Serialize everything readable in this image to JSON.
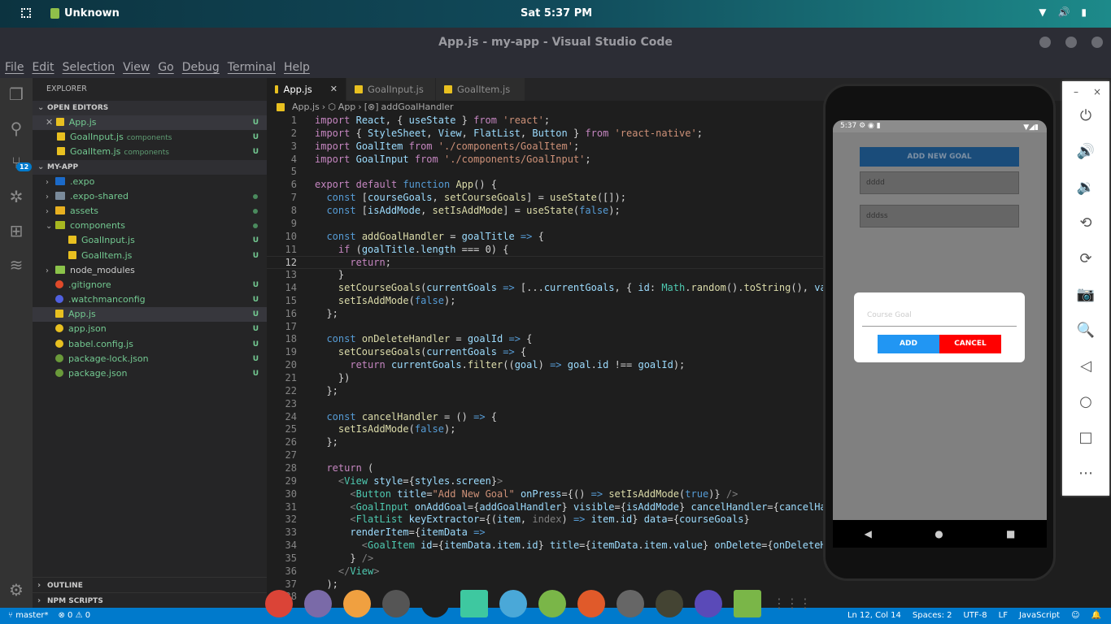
{
  "topbar": {
    "app_name": "Unknown",
    "clock": "Sat  5:37 PM",
    "tray_icons": [
      "wifi-icon",
      "volume-icon",
      "battery-icon"
    ]
  },
  "window": {
    "title": "App.js - my-app - Visual Studio Code"
  },
  "menu": [
    "File",
    "Edit",
    "Selection",
    "View",
    "Go",
    "Debug",
    "Terminal",
    "Help"
  ],
  "activity": {
    "icons": [
      "files-icon",
      "search-icon",
      "source-control-icon",
      "debug-icon",
      "extensions-icon",
      "docker-icon",
      "gear-icon"
    ],
    "scm_badge": "12"
  },
  "sidebar": {
    "title": "EXPLORER",
    "open_editors_label": "OPEN EDITORS",
    "open_editors": [
      {
        "name": "App.js",
        "desc": "",
        "status": "U"
      },
      {
        "name": "GoalInput.js",
        "desc": "components",
        "status": "U"
      },
      {
        "name": "GoalItem.js",
        "desc": "components",
        "status": "U"
      }
    ],
    "project_label": "MY-APP",
    "tree": [
      {
        "name": ".expo",
        "kind": "folder",
        "depth": 0,
        "chev": "›",
        "status": "",
        "color": "#1b6ac9"
      },
      {
        "name": ".expo-shared",
        "kind": "folder",
        "depth": 0,
        "chev": "›",
        "status": "dot",
        "color": "#7a8a9a"
      },
      {
        "name": "assets",
        "kind": "folder",
        "depth": 0,
        "chev": "›",
        "status": "dot",
        "color": "#e8b020"
      },
      {
        "name": "components",
        "kind": "folder",
        "depth": 0,
        "chev": "⌄",
        "status": "dot",
        "color": "#a8b820"
      },
      {
        "name": "GoalInput.js",
        "kind": "js",
        "depth": 1,
        "chev": "",
        "status": "U"
      },
      {
        "name": "GoalItem.js",
        "kind": "js",
        "depth": 1,
        "chev": "",
        "status": "U"
      },
      {
        "name": "node_modules",
        "kind": "folder",
        "depth": 0,
        "chev": "›",
        "status": "",
        "color": "#8bc34a"
      },
      {
        "name": ".gitignore",
        "kind": "other",
        "depth": 0,
        "chev": "",
        "status": "U",
        "color": "#e04a2a"
      },
      {
        "name": ".watchmanconfig",
        "kind": "other",
        "depth": 0,
        "chev": "",
        "status": "U",
        "color": "#5060e0"
      },
      {
        "name": "App.js",
        "kind": "js",
        "depth": 0,
        "chev": "",
        "status": "U",
        "selected": true
      },
      {
        "name": "app.json",
        "kind": "other",
        "depth": 0,
        "chev": "",
        "status": "U",
        "color": "#e8c020"
      },
      {
        "name": "babel.config.js",
        "kind": "other",
        "depth": 0,
        "chev": "",
        "status": "U",
        "color": "#e8c020"
      },
      {
        "name": "package-lock.json",
        "kind": "other",
        "depth": 0,
        "chev": "",
        "status": "U",
        "color": "#6a9a3a"
      },
      {
        "name": "package.json",
        "kind": "other",
        "depth": 0,
        "chev": "",
        "status": "U",
        "color": "#6a9a3a"
      }
    ],
    "outline_label": "OUTLINE",
    "npm_label": "NPM SCRIPTS"
  },
  "tabs": [
    {
      "label": "App.js",
      "active": true
    },
    {
      "label": "GoalInput.js"
    },
    {
      "label": "GoalItem.js"
    }
  ],
  "breadcrumb": [
    "App.js",
    "App",
    "addGoalHandler"
  ],
  "editor": {
    "current_line": 12,
    "lines": [
      [
        [
          "k",
          "import"
        ],
        [
          "p",
          " "
        ],
        [
          "v",
          "React"
        ],
        [
          "p",
          ", { "
        ],
        [
          "v",
          "useState"
        ],
        [
          "p",
          " } "
        ],
        [
          "k",
          "from"
        ],
        [
          "p",
          " "
        ],
        [
          "s",
          "'react'"
        ],
        [
          "p",
          ";"
        ]
      ],
      [
        [
          "k",
          "import"
        ],
        [
          "p",
          " { "
        ],
        [
          "v",
          "StyleSheet"
        ],
        [
          "p",
          ", "
        ],
        [
          "v",
          "View"
        ],
        [
          "p",
          ", "
        ],
        [
          "v",
          "FlatList"
        ],
        [
          "p",
          ", "
        ],
        [
          "v",
          "Button"
        ],
        [
          "p",
          " } "
        ],
        [
          "k",
          "from"
        ],
        [
          "p",
          " "
        ],
        [
          "s",
          "'react-native'"
        ],
        [
          "p",
          ";"
        ]
      ],
      [
        [
          "k",
          "import"
        ],
        [
          "p",
          " "
        ],
        [
          "v",
          "GoalItem"
        ],
        [
          "p",
          " "
        ],
        [
          "k",
          "from"
        ],
        [
          "p",
          " "
        ],
        [
          "s",
          "'./components/GoalItem'"
        ],
        [
          "p",
          ";"
        ]
      ],
      [
        [
          "k",
          "import"
        ],
        [
          "p",
          " "
        ],
        [
          "v",
          "GoalInput"
        ],
        [
          "p",
          " "
        ],
        [
          "k",
          "from"
        ],
        [
          "p",
          " "
        ],
        [
          "s",
          "'./components/GoalInput'"
        ],
        [
          "p",
          ";"
        ]
      ],
      [],
      [
        [
          "k",
          "export"
        ],
        [
          "p",
          " "
        ],
        [
          "k",
          "default"
        ],
        [
          "p",
          " "
        ],
        [
          "b",
          "function"
        ],
        [
          "p",
          " "
        ],
        [
          "f",
          "App"
        ],
        [
          "p",
          "() {"
        ]
      ],
      [
        [
          "p",
          "  "
        ],
        [
          "b",
          "const"
        ],
        [
          "p",
          " ["
        ],
        [
          "v",
          "courseGoals"
        ],
        [
          "p",
          ", "
        ],
        [
          "f",
          "setCourseGoals"
        ],
        [
          "p",
          "] = "
        ],
        [
          "f",
          "useState"
        ],
        [
          "p",
          "([]);"
        ]
      ],
      [
        [
          "p",
          "  "
        ],
        [
          "b",
          "const"
        ],
        [
          "p",
          " ["
        ],
        [
          "v",
          "isAddMode"
        ],
        [
          "p",
          ", "
        ],
        [
          "f",
          "setIsAddMode"
        ],
        [
          "p",
          "] = "
        ],
        [
          "f",
          "useState"
        ],
        [
          "p",
          "("
        ],
        [
          "b",
          "false"
        ],
        [
          "p",
          ");"
        ]
      ],
      [],
      [
        [
          "p",
          "  "
        ],
        [
          "b",
          "const"
        ],
        [
          "p",
          " "
        ],
        [
          "f",
          "addGoalHandler"
        ],
        [
          "p",
          " = "
        ],
        [
          "v",
          "goalTitle"
        ],
        [
          "p",
          " "
        ],
        [
          "b",
          "=>"
        ],
        [
          "p",
          " {"
        ]
      ],
      [
        [
          "p",
          "    "
        ],
        [
          "k",
          "if"
        ],
        [
          "p",
          " ("
        ],
        [
          "v",
          "goalTitle"
        ],
        [
          "p",
          "."
        ],
        [
          "v",
          "length"
        ],
        [
          "p",
          " === "
        ],
        [
          "p",
          "0"
        ],
        [
          "p",
          ") {"
        ]
      ],
      [
        [
          "p",
          "      "
        ],
        [
          "k",
          "return"
        ],
        [
          "p",
          ";"
        ]
      ],
      [
        [
          "p",
          "    }"
        ]
      ],
      [
        [
          "p",
          "    "
        ],
        [
          "f",
          "setCourseGoals"
        ],
        [
          "p",
          "("
        ],
        [
          "v",
          "currentGoals"
        ],
        [
          "p",
          " "
        ],
        [
          "b",
          "=>"
        ],
        [
          "p",
          " [..."
        ],
        [
          "v",
          "currentGoals"
        ],
        [
          "p",
          ", { "
        ],
        [
          "v",
          "id"
        ],
        [
          "p",
          ": "
        ],
        [
          "g",
          "Math"
        ],
        [
          "p",
          "."
        ],
        [
          "f",
          "random"
        ],
        [
          "p",
          "()."
        ],
        [
          "f",
          "toString"
        ],
        [
          "p",
          "(), "
        ],
        [
          "v",
          "valu"
        ]
      ],
      [
        [
          "p",
          "    "
        ],
        [
          "f",
          "setIsAddMode"
        ],
        [
          "p",
          "("
        ],
        [
          "b",
          "false"
        ],
        [
          "p",
          ");"
        ]
      ],
      [
        [
          "p",
          "  };"
        ]
      ],
      [],
      [
        [
          "p",
          "  "
        ],
        [
          "b",
          "const"
        ],
        [
          "p",
          " "
        ],
        [
          "f",
          "onDeleteHandler"
        ],
        [
          "p",
          " = "
        ],
        [
          "v",
          "goalId"
        ],
        [
          "p",
          " "
        ],
        [
          "b",
          "=>"
        ],
        [
          "p",
          " {"
        ]
      ],
      [
        [
          "p",
          "    "
        ],
        [
          "f",
          "setCourseGoals"
        ],
        [
          "p",
          "("
        ],
        [
          "v",
          "currentGoals"
        ],
        [
          "p",
          " "
        ],
        [
          "b",
          "=>"
        ],
        [
          "p",
          " {"
        ]
      ],
      [
        [
          "p",
          "      "
        ],
        [
          "k",
          "return"
        ],
        [
          "p",
          " "
        ],
        [
          "v",
          "currentGoals"
        ],
        [
          "p",
          "."
        ],
        [
          "f",
          "filter"
        ],
        [
          "p",
          "(("
        ],
        [
          "v",
          "goal"
        ],
        [
          "p",
          ") "
        ],
        [
          "b",
          "=>"
        ],
        [
          "p",
          " "
        ],
        [
          "v",
          "goal"
        ],
        [
          "p",
          "."
        ],
        [
          "v",
          "id"
        ],
        [
          "p",
          " !== "
        ],
        [
          "v",
          "goalId"
        ],
        [
          "p",
          ");"
        ]
      ],
      [
        [
          "p",
          "    })"
        ]
      ],
      [
        [
          "p",
          "  };"
        ]
      ],
      [],
      [
        [
          "p",
          "  "
        ],
        [
          "b",
          "const"
        ],
        [
          "p",
          " "
        ],
        [
          "f",
          "cancelHandler"
        ],
        [
          "p",
          " = () "
        ],
        [
          "b",
          "=>"
        ],
        [
          "p",
          " {"
        ]
      ],
      [
        [
          "p",
          "    "
        ],
        [
          "f",
          "setIsAddMode"
        ],
        [
          "p",
          "("
        ],
        [
          "b",
          "false"
        ],
        [
          "p",
          ");"
        ]
      ],
      [
        [
          "p",
          "  };"
        ]
      ],
      [],
      [
        [
          "p",
          "  "
        ],
        [
          "k",
          "return"
        ],
        [
          "p",
          " ("
        ]
      ],
      [
        [
          "p",
          "    "
        ],
        [
          "m",
          "<"
        ],
        [
          "g",
          "View"
        ],
        [
          "p",
          " "
        ],
        [
          "v",
          "style"
        ],
        [
          "p",
          "={"
        ],
        [
          "v",
          "styles"
        ],
        [
          "p",
          "."
        ],
        [
          "v",
          "screen"
        ],
        [
          "p",
          "}"
        ],
        [
          "m",
          ">"
        ]
      ],
      [
        [
          "p",
          "      "
        ],
        [
          "m",
          "<"
        ],
        [
          "g",
          "Button"
        ],
        [
          "p",
          " "
        ],
        [
          "v",
          "title"
        ],
        [
          "p",
          "="
        ],
        [
          "s",
          "\"Add New Goal\""
        ],
        [
          "p",
          " "
        ],
        [
          "v",
          "onPress"
        ],
        [
          "p",
          "={() "
        ],
        [
          "b",
          "=>"
        ],
        [
          "p",
          " "
        ],
        [
          "f",
          "setIsAddMode"
        ],
        [
          "p",
          "("
        ],
        [
          "b",
          "true"
        ],
        [
          "p",
          ")} "
        ],
        [
          "m",
          "/>"
        ]
      ],
      [
        [
          "p",
          "      "
        ],
        [
          "m",
          "<"
        ],
        [
          "g",
          "GoalInput"
        ],
        [
          "p",
          " "
        ],
        [
          "v",
          "onAddGoal"
        ],
        [
          "p",
          "={"
        ],
        [
          "v",
          "addGoalHandler"
        ],
        [
          "p",
          "} "
        ],
        [
          "v",
          "visible"
        ],
        [
          "p",
          "={"
        ],
        [
          "v",
          "isAddMode"
        ],
        [
          "p",
          "} "
        ],
        [
          "v",
          "cancelHandler"
        ],
        [
          "p",
          "={"
        ],
        [
          "v",
          "cancelHand"
        ]
      ],
      [
        [
          "p",
          "      "
        ],
        [
          "m",
          "<"
        ],
        [
          "g",
          "FlatList"
        ],
        [
          "p",
          " "
        ],
        [
          "v",
          "keyExtractor"
        ],
        [
          "p",
          "={("
        ],
        [
          "v",
          "item"
        ],
        [
          "p",
          ", "
        ],
        [
          "m",
          "index"
        ],
        [
          "p",
          ") "
        ],
        [
          "b",
          "=>"
        ],
        [
          "p",
          " "
        ],
        [
          "v",
          "item"
        ],
        [
          "p",
          "."
        ],
        [
          "v",
          "id"
        ],
        [
          "p",
          "} "
        ],
        [
          "v",
          "data"
        ],
        [
          "p",
          "={"
        ],
        [
          "v",
          "courseGoals"
        ],
        [
          "p",
          "}"
        ]
      ],
      [
        [
          "p",
          "      "
        ],
        [
          "v",
          "renderItem"
        ],
        [
          "p",
          "={"
        ],
        [
          "v",
          "itemData"
        ],
        [
          "p",
          " "
        ],
        [
          "b",
          "=>"
        ]
      ],
      [
        [
          "p",
          "        "
        ],
        [
          "m",
          "<"
        ],
        [
          "g",
          "GoalItem"
        ],
        [
          "p",
          " "
        ],
        [
          "v",
          "id"
        ],
        [
          "p",
          "={"
        ],
        [
          "v",
          "itemData"
        ],
        [
          "p",
          "."
        ],
        [
          "v",
          "item"
        ],
        [
          "p",
          "."
        ],
        [
          "v",
          "id"
        ],
        [
          "p",
          "} "
        ],
        [
          "v",
          "title"
        ],
        [
          "p",
          "={"
        ],
        [
          "v",
          "itemData"
        ],
        [
          "p",
          "."
        ],
        [
          "v",
          "item"
        ],
        [
          "p",
          "."
        ],
        [
          "v",
          "value"
        ],
        [
          "p",
          "} "
        ],
        [
          "v",
          "onDelete"
        ],
        [
          "p",
          "={"
        ],
        [
          "v",
          "onDeleteHan"
        ]
      ],
      [
        [
          "p",
          "      } "
        ],
        [
          "m",
          "/>"
        ]
      ],
      [
        [
          "p",
          "    "
        ],
        [
          "m",
          "</"
        ],
        [
          "g",
          "View"
        ],
        [
          "m",
          ">"
        ]
      ],
      [
        [
          "p",
          "  );"
        ]
      ]
    ]
  },
  "status": {
    "branch": "master*",
    "errors": "0",
    "warnings": "0",
    "position": "Ln 12, Col 14",
    "spaces": "Spaces: 2",
    "encoding": "UTF-8",
    "eol": "LF",
    "language": "JavaScript"
  },
  "dock": [
    {
      "name": "chrome",
      "color": "#db4437"
    },
    {
      "name": "files",
      "color": "#7a6aa8"
    },
    {
      "name": "software-center",
      "color": "#f0a040"
    },
    {
      "name": "terminal",
      "color": "#555"
    },
    {
      "name": "vscode",
      "color": "#1e1e1e"
    },
    {
      "name": "app",
      "color": "#3ec8a0"
    },
    {
      "name": "opera",
      "color": "#4aa8d8"
    },
    {
      "name": "android-studio",
      "color": "#7ab648"
    },
    {
      "name": "firefox",
      "color": "#e05a2a"
    },
    {
      "name": "settings",
      "color": "#666"
    },
    {
      "name": "gimp",
      "color": "#443"
    },
    {
      "name": "eclipse",
      "color": "#5a4ab8"
    },
    {
      "name": "device",
      "color": "#7ab648"
    }
  ],
  "phone": {
    "time": "5:37",
    "add_button": "ADD NEW GOAL",
    "goals": [
      "dddd",
      "dddss"
    ],
    "modal": {
      "placeholder": "Course Goal",
      "add": "ADD",
      "cancel": "CANCEL"
    }
  },
  "emulator_controls": [
    "power-icon",
    "volume-up-icon",
    "volume-down-icon",
    "rotate-left-icon",
    "rotate-right-icon",
    "camera-icon",
    "zoom-icon",
    "back-icon",
    "home-icon",
    "overview-icon",
    "more-icon"
  ]
}
